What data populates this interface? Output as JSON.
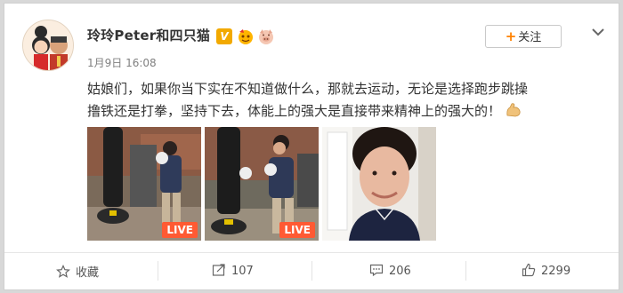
{
  "user": {
    "name": "玲玲Peter和四只猫",
    "verified_mark": "V"
  },
  "post": {
    "timestamp": "1月9日 16:08",
    "text": "姑娘们，如果你当下实在不知道做什么，那就去运动，无论是选择跑步跳操撸铁还是打拳，坚持下去，体能上的强大是直接带来精神上的强大的！",
    "emoji": "flexed-biceps-icon"
  },
  "follow_button": {
    "label": "关注"
  },
  "photos": [
    {
      "badge": "LIVE"
    },
    {
      "badge": "LIVE"
    },
    {
      "badge": ""
    }
  ],
  "actions": {
    "favorite": "收藏",
    "repost_count": "107",
    "comment_count": "206",
    "like_count": "2299"
  },
  "colors": {
    "accent": "#ff8200",
    "live": "#ff5a33",
    "verified": "#f2a900"
  }
}
